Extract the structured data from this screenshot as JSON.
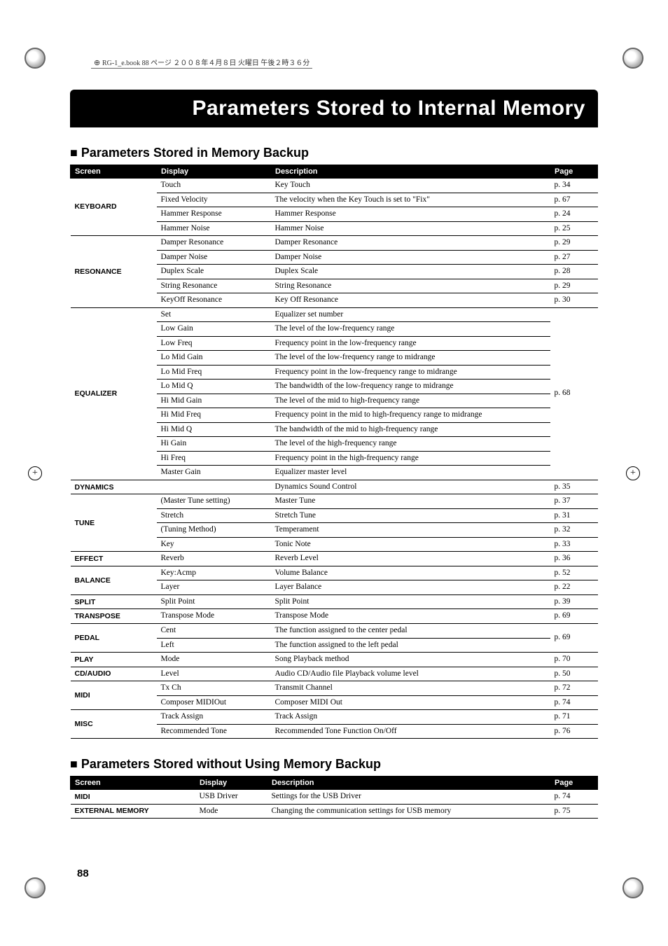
{
  "header_note": "RG-1_e.book 88 ページ ２００８年４月８日 火曜日 午後２時３６分",
  "title": "Parameters Stored to Internal Memory",
  "section1": {
    "heading": "Parameters Stored in Memory Backup",
    "columns": {
      "screen": "Screen",
      "display": "Display",
      "description": "Description",
      "page": "Page"
    },
    "groups": [
      {
        "screen": "KEYBOARD",
        "rows": [
          {
            "display": "Touch",
            "description": "Key Touch",
            "page": "p. 34"
          },
          {
            "display": "Fixed Velocity",
            "description": "The velocity when the Key Touch is set to \"Fix\"",
            "page": "p. 67"
          },
          {
            "display": "Hammer Response",
            "description": "Hammer Response",
            "page": "p. 24"
          },
          {
            "display": "Hammer Noise",
            "description": "Hammer Noise",
            "page": "p. 25"
          }
        ]
      },
      {
        "screen": "RESONANCE",
        "rows": [
          {
            "display": "Damper Resonance",
            "description": "Damper Resonance",
            "page": "p. 29"
          },
          {
            "display": "Damper Noise",
            "description": "Damper Noise",
            "page": "p. 27"
          },
          {
            "display": "Duplex Scale",
            "description": "Duplex Scale",
            "page": "p. 28"
          },
          {
            "display": "String Resonance",
            "description": "String Resonance",
            "page": "p. 29"
          },
          {
            "display": "KeyOff Resonance",
            "description": "Key Off Resonance",
            "page": "p. 30"
          }
        ]
      },
      {
        "screen": "EQUALIZER",
        "page": "p. 68",
        "rows": [
          {
            "display": "Set",
            "description": "Equalizer set number"
          },
          {
            "display": "Low Gain",
            "description": "The level of the low-frequency range"
          },
          {
            "display": "Low Freq",
            "description": "Frequency point in the low-frequency range"
          },
          {
            "display": "Lo Mid Gain",
            "description": "The level of the low-frequency range to midrange"
          },
          {
            "display": "Lo Mid Freq",
            "description": "Frequency point in the low-frequency range to midrange"
          },
          {
            "display": "Lo Mid Q",
            "description": "The bandwidth of the low-frequency range to midrange"
          },
          {
            "display": "Hi Mid Gain",
            "description": "The level of the mid to high-frequency range"
          },
          {
            "display": "Hi Mid Freq",
            "description": "Frequency point in the mid to high-frequency range to midrange"
          },
          {
            "display": "Hi Mid Q",
            "description": "The bandwidth of the mid to high-frequency range"
          },
          {
            "display": "Hi Gain",
            "description": "The level of the high-frequency range"
          },
          {
            "display": "Hi Freq",
            "description": "Frequency point in the high-frequency range"
          },
          {
            "display": "Master Gain",
            "description": "Equalizer master level"
          }
        ]
      },
      {
        "screen": "DYNAMICS",
        "span_display": true,
        "rows": [
          {
            "description": "Dynamics Sound Control",
            "page": "p. 35"
          }
        ]
      },
      {
        "screen": "TUNE",
        "rows": [
          {
            "display": "(Master Tune setting)",
            "description": "Master Tune",
            "page": "p. 37"
          },
          {
            "display": "Stretch",
            "description": "Stretch Tune",
            "page": "p. 31"
          },
          {
            "display": "(Tuning Method)",
            "description": "Temperament",
            "page": "p. 32"
          },
          {
            "display": "Key",
            "description": "Tonic Note",
            "page": "p. 33"
          }
        ]
      },
      {
        "screen": "EFFECT",
        "rows": [
          {
            "display": "Reverb",
            "description": "Reverb Level",
            "page": "p. 36"
          }
        ]
      },
      {
        "screen": "BALANCE",
        "rows": [
          {
            "display": "Key:Acmp",
            "description": "Volume Balance",
            "page": "p. 52"
          },
          {
            "display": "Layer",
            "description": "Layer Balance",
            "page": "p. 22"
          }
        ]
      },
      {
        "screen": "SPLIT",
        "rows": [
          {
            "display": "Split Point",
            "description": "Split Point",
            "page": "p. 39"
          }
        ]
      },
      {
        "screen": "TRANSPOSE",
        "rows": [
          {
            "display": "Transpose Mode",
            "description": "Transpose Mode",
            "page": "p. 69"
          }
        ]
      },
      {
        "screen": "PEDAL",
        "page": "p. 69",
        "rows": [
          {
            "display": "Cent",
            "description": "The function assigned to the center pedal"
          },
          {
            "display": "Left",
            "description": "The function assigned to the left pedal"
          }
        ]
      },
      {
        "screen": "PLAY",
        "rows": [
          {
            "display": "Mode",
            "description": "Song Playback method",
            "page": "p. 70"
          }
        ]
      },
      {
        "screen": "CD/AUDIO",
        "rows": [
          {
            "display": "Level",
            "description": "Audio CD/Audio file Playback volume level",
            "page": "p. 50"
          }
        ]
      },
      {
        "screen": "MIDI",
        "rows": [
          {
            "display": "Tx Ch",
            "description": "Transmit Channel",
            "page": "p. 72"
          },
          {
            "display": "Composer MIDIOut",
            "description": "Composer MIDI Out",
            "page": "p. 74"
          }
        ]
      },
      {
        "screen": "MISC",
        "rows": [
          {
            "display": "Track Assign",
            "description": "Track Assign",
            "page": "p. 71"
          },
          {
            "display": "Recommended Tone",
            "description": "Recommended Tone Function On/Off",
            "page": "p. 76"
          }
        ]
      }
    ]
  },
  "section2": {
    "heading": "Parameters Stored without Using Memory Backup",
    "columns": {
      "screen": "Screen",
      "display": "Display",
      "description": "Description",
      "page": "Page"
    },
    "rows": [
      {
        "screen": "MIDI",
        "display": "USB Driver",
        "description": "Settings for the USB Driver",
        "page": "p. 74"
      },
      {
        "screen": "EXTERNAL MEMORY",
        "display": "Mode",
        "description": "Changing the communication settings for USB memory",
        "page": "p. 75"
      }
    ]
  },
  "page_number": "88"
}
